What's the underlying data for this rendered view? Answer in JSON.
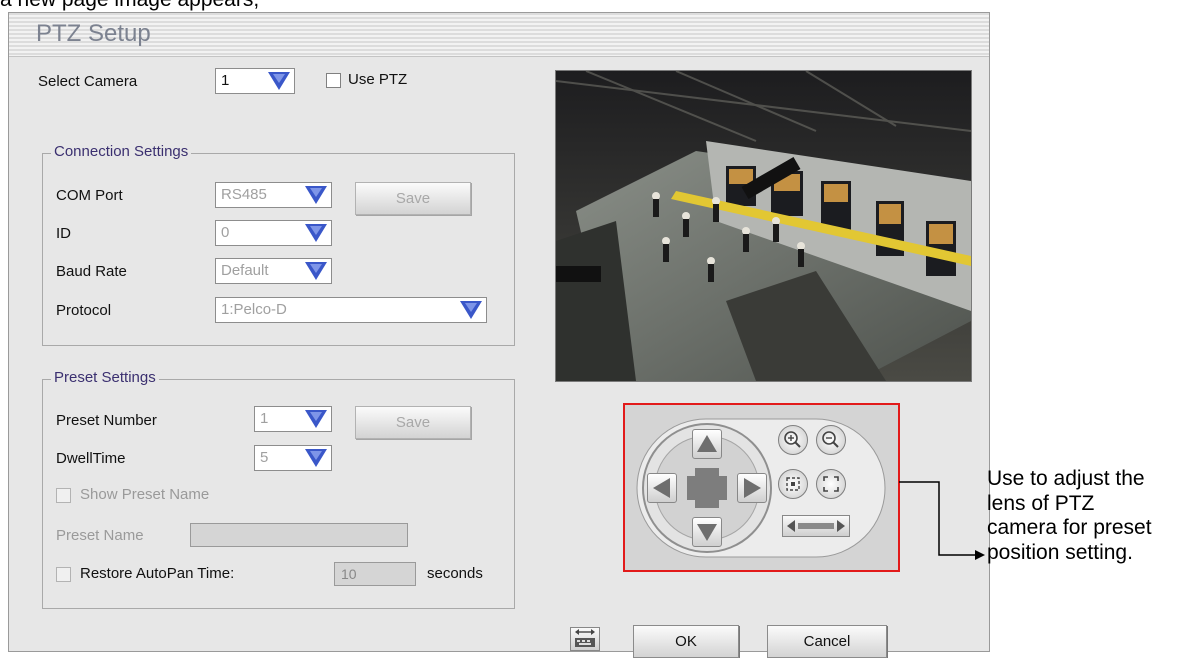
{
  "top_caption": "a new page image appears,",
  "window": {
    "title": "PTZ Setup"
  },
  "camera_select": {
    "label": "Select Camera",
    "value": "1",
    "use_ptz_label": "Use PTZ"
  },
  "connection": {
    "legend": "Connection Settings",
    "com_port_label": "COM Port",
    "com_port_value": "RS485",
    "id_label": "ID",
    "id_value": "0",
    "baud_label": "Baud Rate",
    "baud_value": "Default",
    "protocol_label": "Protocol",
    "protocol_value": "1:Pelco-D",
    "save_label": "Save"
  },
  "preset": {
    "legend": "Preset Settings",
    "number_label": "Preset Number",
    "number_value": "1",
    "dwell_label": "DwellTime",
    "dwell_value": "5",
    "save_label": "Save",
    "show_name_label": "Show Preset Name",
    "name_label": "Preset Name",
    "name_value": "",
    "restore_label": "Restore AutoPan Time:",
    "restore_value": "10",
    "seconds_label": "seconds"
  },
  "buttons": {
    "ok": "OK",
    "cancel": "Cancel"
  },
  "annotation": {
    "lines": [
      "Use to adjust the",
      "lens of PTZ",
      "camera for preset",
      "position setting."
    ]
  },
  "colors": {
    "highlight": "#e21a1a",
    "legend_text": "#3b3070",
    "combo_arrow": "#3a57c9"
  }
}
